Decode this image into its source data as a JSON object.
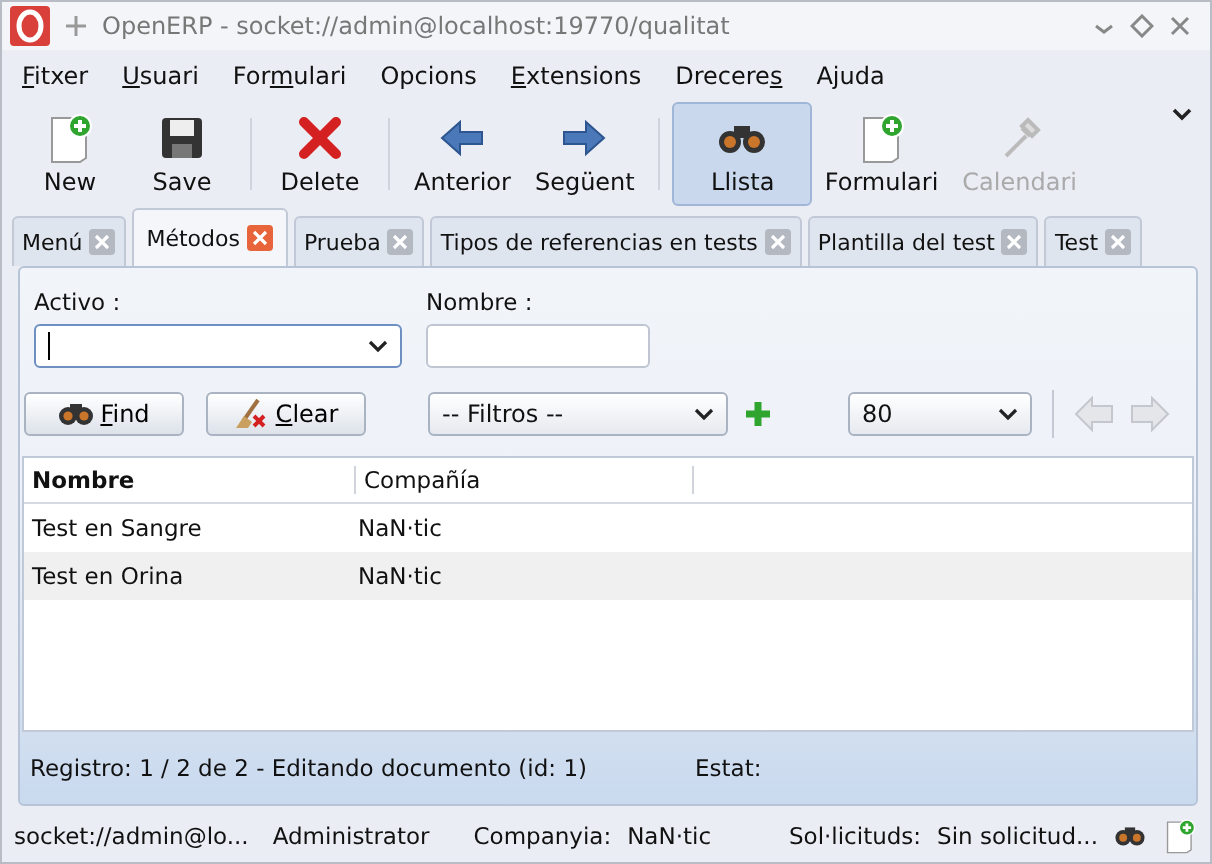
{
  "window": {
    "title": "OpenERP - socket://admin@localhost:19770/qualitat"
  },
  "menu": [
    {
      "key": "F",
      "post": "itxer"
    },
    {
      "key": "U",
      "post": "suari"
    },
    {
      "pre": "For",
      "key": "m",
      "post": "ulari"
    },
    {
      "pre": "Opcions"
    },
    {
      "key": "E",
      "post": "xtensions"
    },
    {
      "pre": "Drecere",
      "key": "s"
    },
    {
      "pre": "Ajuda"
    }
  ],
  "toolbar": [
    [
      {
        "kind": "new",
        "label": "New",
        "selected": false,
        "disabled": false
      },
      {
        "kind": "save",
        "label": "Save",
        "selected": false,
        "disabled": false
      }
    ],
    [
      {
        "kind": "delete",
        "label": "Delete",
        "selected": false,
        "disabled": false
      }
    ],
    [
      {
        "kind": "prev",
        "label": "Anterior",
        "selected": false,
        "disabled": false
      },
      {
        "kind": "next",
        "label": "Següent",
        "selected": false,
        "disabled": false
      }
    ],
    [
      {
        "kind": "list",
        "label": "Llista",
        "selected": true,
        "disabled": false
      },
      {
        "kind": "form",
        "label": "Formulari",
        "selected": false,
        "disabled": false
      },
      {
        "kind": "calendar",
        "label": "Calendari",
        "selected": false,
        "disabled": true
      }
    ]
  ],
  "tabs": [
    {
      "label": "Menú",
      "selected": false
    },
    {
      "label": "Métodos",
      "selected": true
    },
    {
      "label": "Prueba",
      "selected": false
    },
    {
      "label": "Tipos de referencias en tests",
      "selected": false
    },
    {
      "label": "Plantilla del test",
      "selected": false
    },
    {
      "label": "Test",
      "selected": false
    }
  ],
  "search": {
    "activo": {
      "label": "Activo :",
      "focused": true
    },
    "nombre": {
      "label": "Nombre :"
    },
    "find": {
      "key": "F",
      "post": "ind"
    },
    "clear": {
      "key": "C",
      "post": "lear"
    },
    "filter": {
      "value": "-- Filtros --"
    },
    "limit": {
      "value": "80"
    }
  },
  "table": {
    "columns": [
      {
        "label": "Nombre",
        "sorted": true
      },
      {
        "label": "Compañía",
        "sorted": false
      }
    ],
    "rows": [
      [
        "Test en Sangre",
        "NaN·tic"
      ],
      [
        "Test en Orina",
        "NaN·tic"
      ]
    ]
  },
  "record_status": {
    "record": "Registro: 1 / 2 de 2 - Editando documento (id: 1)",
    "state": "Estat:"
  },
  "status_bar": {
    "server": "socket://admin@lo...",
    "user": "Administrator",
    "company_label": "Companyia:",
    "company": "NaN·tic",
    "requests_label": "Sol·licituds:",
    "requests": "Sin solicitud..."
  }
}
